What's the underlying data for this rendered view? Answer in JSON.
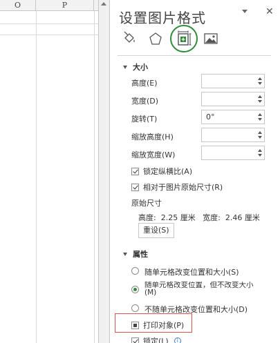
{
  "sheet": {
    "columns": [
      "O",
      "P"
    ]
  },
  "pane": {
    "title": "设置图片格式",
    "tabs": [
      {
        "icon": "fill-line-icon"
      },
      {
        "icon": "effects-icon"
      },
      {
        "icon": "size-properties-icon",
        "active": true
      },
      {
        "icon": "picture-icon"
      }
    ],
    "size_section": {
      "title": "大小",
      "height_label": "高度(E)",
      "height_value": "",
      "width_label": "宽度(D)",
      "width_value": "",
      "rotation_label": "旋转(T)",
      "rotation_value": "0°",
      "scale_height_label": "缩放高度(H)",
      "scale_height_value": "",
      "scale_width_label": "缩放宽度(W)",
      "scale_width_value": "",
      "lock_aspect_label": "锁定纵横比(A)",
      "lock_aspect_checked": true,
      "relative_original_label": "相对于图片原始尺寸(R)",
      "relative_original_checked": true,
      "original_size_label": "原始尺寸",
      "original_dims": "高度:  2.25 厘米   宽度:  2.46 厘米",
      "reset_label": "重设(S)"
    },
    "properties_section": {
      "title": "属性",
      "radio_move_size": "随单元格改变位置和大小(S)",
      "radio_move_only": "随单元格改变位置，但不改变大小(M)",
      "radio_no_move": "不随单元格改变位置和大小(D)",
      "print_object_label": "打印对象(P)",
      "locked_label": "锁定(L)"
    },
    "accent_color": "#2e8b3a",
    "highlight_color": "#e05050"
  }
}
